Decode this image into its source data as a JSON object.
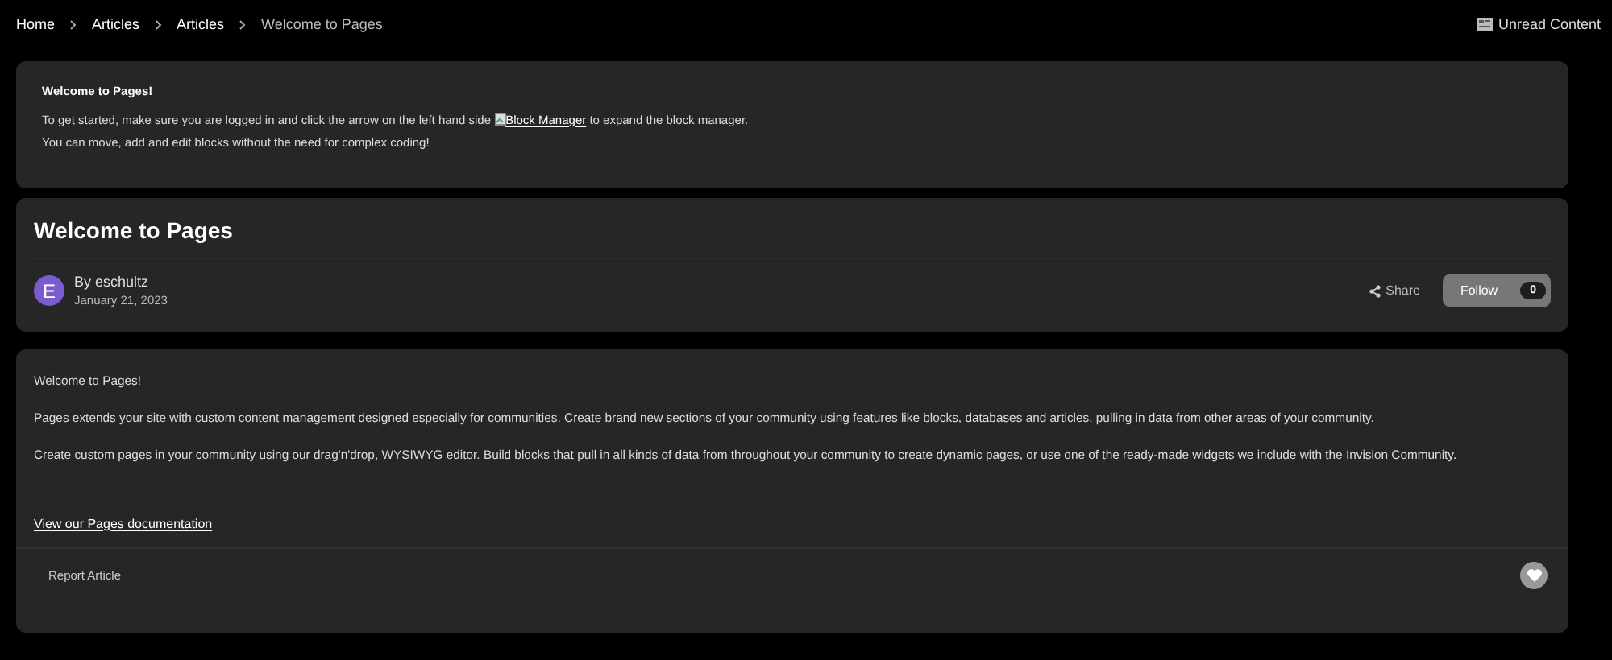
{
  "breadcrumb": [
    {
      "label": "Home"
    },
    {
      "label": "Articles"
    },
    {
      "label": "Articles"
    },
    {
      "label": "Welcome to Pages"
    }
  ],
  "unread_content": {
    "label": "Unread Content"
  },
  "notice": {
    "title": "Welcome to Pages!",
    "line1_before": "To get started, make sure you are logged in and click the arrow on the left hand side",
    "link": "Block Manager",
    "line1_after": "to expand the block manager.",
    "line2": "You can move, add and edit blocks without the need for complex coding!"
  },
  "article": {
    "title": "Welcome to Pages",
    "avatar_letter": "E",
    "author": "By eschultz",
    "date": "January 21, 2023",
    "share": "Share",
    "follow": "Follow",
    "follow_count": "0"
  },
  "body": {
    "paragraphs": [
      "Welcome to Pages!",
      "Pages extends your site with custom content management designed especially for communities. Create brand new sections of your community using features like blocks, databases and articles, pulling in data from other areas of your community.",
      "Create custom pages in your community using our drag'n'drop, WYSIWYG editor. Build blocks that pull in all kinds of data from throughout your community to create dynamic pages, or use one of the ready-made widgets we include with the Invision Community."
    ],
    "doc_link": "View our Pages documentation",
    "report": "Report Article"
  }
}
